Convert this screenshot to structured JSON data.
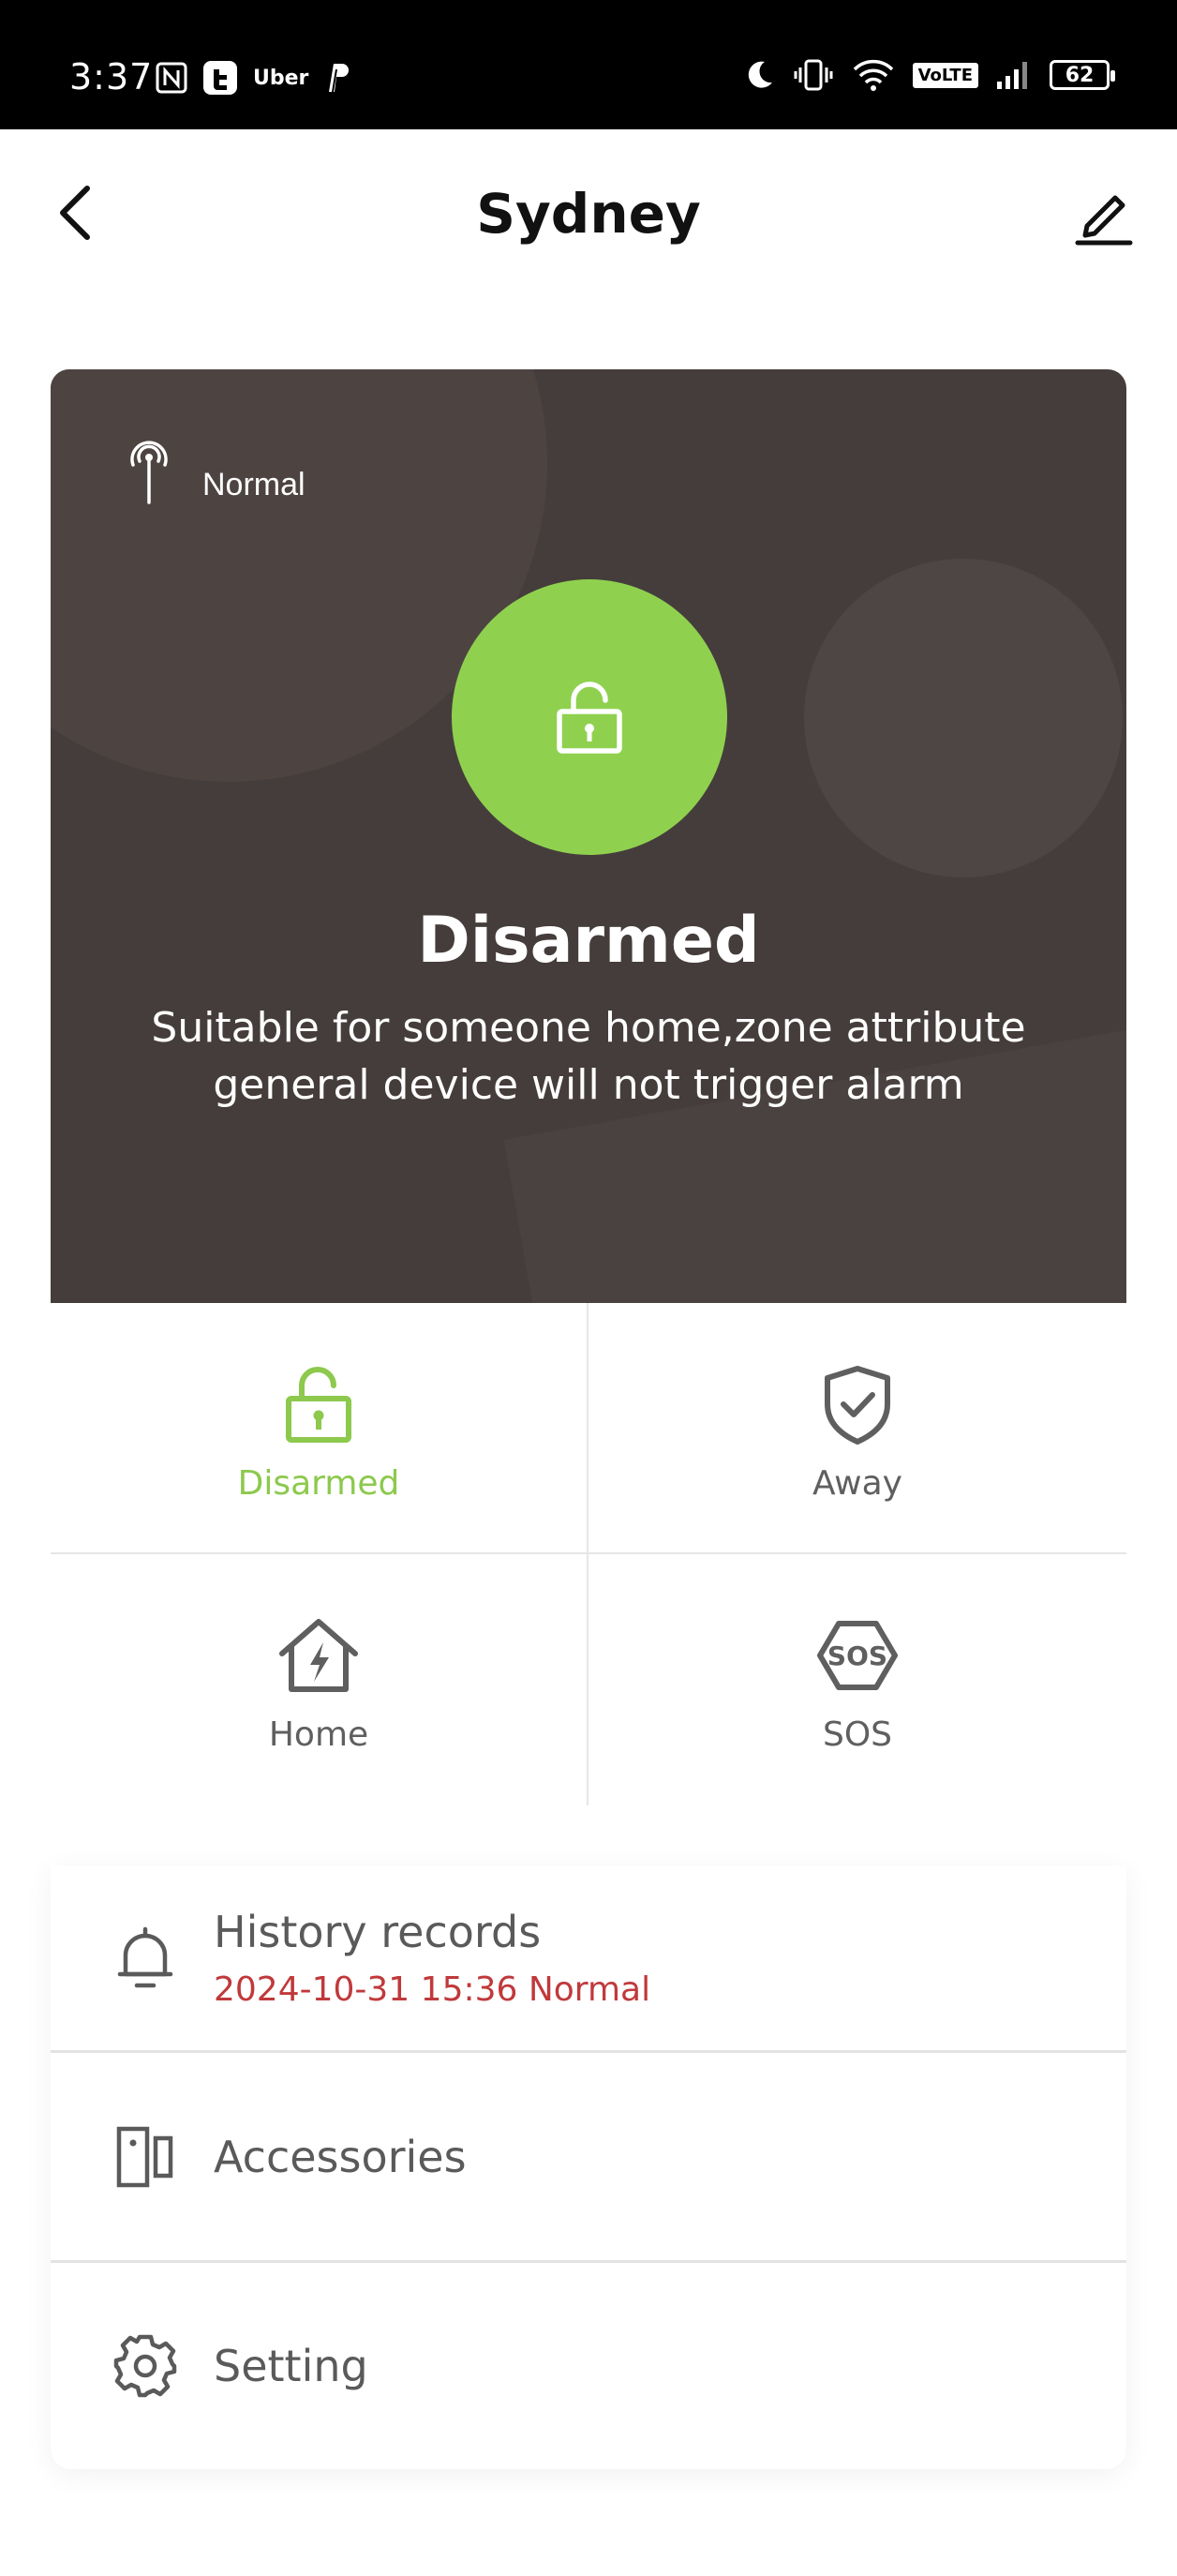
{
  "status_bar": {
    "time": "3:37",
    "left_icons": [
      "nfc-icon",
      "t-app-icon",
      "uber-icon",
      "paypal-icon"
    ],
    "uber_text": "Uber",
    "right_icons": [
      "moon-icon",
      "vibrate-icon",
      "wifi-icon",
      "volte-icon",
      "cell-signal-icon",
      "battery-icon"
    ],
    "volte_text": "VoLTE",
    "battery_level": "62"
  },
  "header": {
    "title": "Sydney",
    "back_icon": "chevron-left-icon",
    "edit_icon": "pencil-icon"
  },
  "status_card": {
    "signal_label": "Normal",
    "mode_title": "Disarmed",
    "mode_description": "Suitable for someone home,zone attribute general device will not trigger alarm",
    "accent_color": "#8fd14f",
    "background_color": "#453d3b"
  },
  "modes": [
    {
      "label": "Disarmed",
      "icon": "unlock-icon",
      "active": true
    },
    {
      "label": "Away",
      "icon": "shield-check-icon",
      "active": false
    },
    {
      "label": "Home",
      "icon": "home-bolt-icon",
      "active": false
    },
    {
      "label": "SOS",
      "icon": "sos-icon",
      "active": false
    }
  ],
  "menu": {
    "history": {
      "title": "History records",
      "subtitle": "2024-10-31 15:36 Normal",
      "icon": "bell-icon",
      "subtitle_color": "#c0393b"
    },
    "accessories": {
      "title": "Accessories",
      "icon": "door-sensor-icon"
    },
    "setting": {
      "title": "Setting",
      "icon": "gear-icon"
    }
  }
}
